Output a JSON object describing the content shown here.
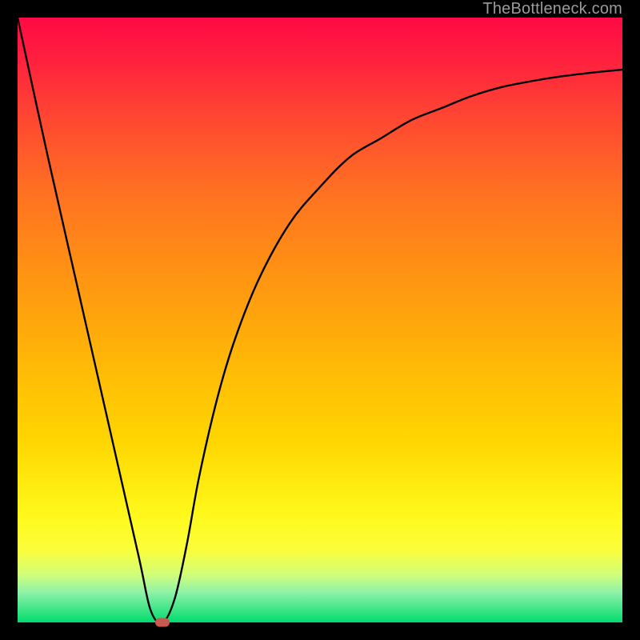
{
  "watermark": "TheBottleneck.com",
  "chart_data": {
    "type": "line",
    "title": "",
    "xlabel": "",
    "ylabel": "",
    "xlim": [
      0,
      100
    ],
    "ylim": [
      0,
      100
    ],
    "grid": false,
    "background_gradient": {
      "top": "#ff0a45",
      "middle": "#ffbf05",
      "bottom": "#00dc6e"
    },
    "series": [
      {
        "name": "bottleneck-curve",
        "color": "#000000",
        "x": [
          0,
          5,
          10,
          15,
          20,
          22,
          24,
          26,
          28,
          30,
          33,
          36,
          40,
          45,
          50,
          55,
          60,
          65,
          70,
          75,
          80,
          85,
          90,
          95,
          100
        ],
        "values": [
          100,
          77,
          55,
          33,
          11,
          2,
          0,
          4,
          13,
          24,
          37,
          47,
          57,
          66,
          72,
          77,
          80,
          83,
          85,
          87,
          88.5,
          89.5,
          90.3,
          90.9,
          91.4
        ]
      }
    ],
    "min_marker": {
      "x": 24,
      "y": 0,
      "color": "#c9594f"
    },
    "frame_color": "#000000"
  }
}
